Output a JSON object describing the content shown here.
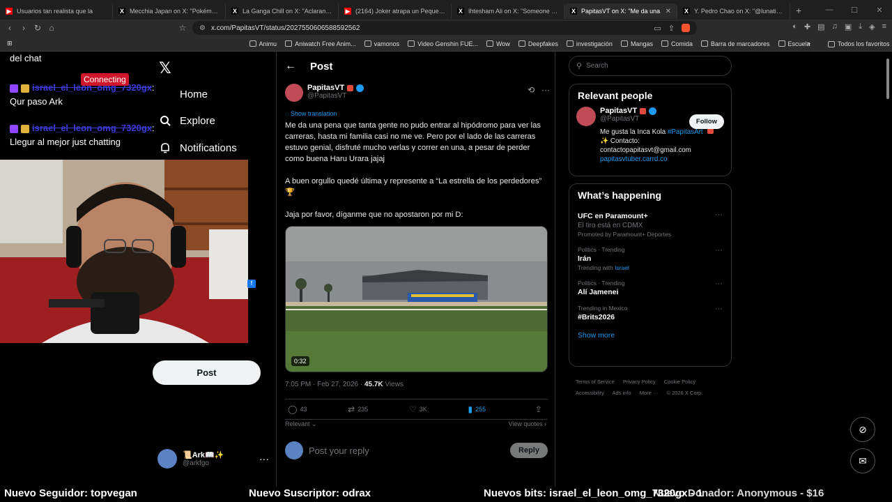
{
  "browser": {
    "tabs": [
      {
        "title": "Usuarios tan realista que la",
        "icon": "youtube-icon",
        "color": "#ff0000",
        "glyph": "▶"
      },
      {
        "title": "Mecchia Japan on X: \"Pokémon Fit",
        "icon": "x-icon",
        "color": "#000000",
        "glyph": "X"
      },
      {
        "title": "La Ganga Chill on X: \"Aclarando la s",
        "icon": "x-icon",
        "color": "#000000",
        "glyph": "X"
      },
      {
        "title": "(2164) Joker atrapa un Pequeño Pok",
        "icon": "youtube-icon",
        "color": "#ff0000",
        "glyph": "▶"
      },
      {
        "title": "Ihtesham Ali on X: \"Someone jus",
        "icon": "x-icon",
        "color": "#000000",
        "glyph": "X"
      },
      {
        "title": "PapitasVT on X: \"Me da una",
        "icon": "x-icon",
        "color": "#000000",
        "glyph": "X",
        "active": true
      },
      {
        "title": "Y. Pedro Chao on X: \"@lunaticmonst",
        "icon": "x-icon",
        "color": "#000000",
        "glyph": "X"
      }
    ],
    "url": "x.com/PapitasVT/status/2027550606588592562",
    "bookmarks": [
      "Animu",
      "Aniwatch Free Anim...",
      "vamonos",
      "Video Genshin FUE...",
      "Wow",
      "Deepfakes",
      "investigación",
      "Mangas",
      "Comida",
      "Barra de marcadores",
      "Escuela"
    ],
    "bookmarks_right": "Todos los favoritos"
  },
  "overlay": {
    "chat": [
      {
        "user": "",
        "msg": "del chat"
      },
      {
        "user": "israel_el_leon_omg_7320gx",
        "msg": ": Qur paso Ark"
      },
      {
        "user": "israel_el_leon_omg_7320gx",
        "msg": ": Llegur al mejor just chatting"
      }
    ],
    "connecting": "Connecting",
    "ticker": [
      "Nuevo Seguidor: topvegan",
      "Nuevo Suscriptor: odrax",
      "Nuevos bits: israel_el_leon_omg_7320gx - 1",
      "Nuevo Donador: Anonymous - $16"
    ]
  },
  "xnav": {
    "items": [
      {
        "label": "Home",
        "icon": "home-icon"
      },
      {
        "label": "Explore",
        "icon": "search-icon"
      },
      {
        "label": "Notifications",
        "icon": "bell-icon"
      }
    ],
    "post_label": "Post",
    "account": {
      "name": "📜Ark📖✨",
      "handle": "@arkfgo"
    }
  },
  "post": {
    "header": "Post",
    "author_name": "PapitasVT",
    "author_handle": "@PapitasVT",
    "show_translation": "Show translation",
    "paragraphs": [
      "Me da una pena que tanta gente no pudo entrar al hipódromo para ver las carreras, hasta mi familia casi no me ve. Pero por el lado de las carreras estuvo genial, disfruté mucho verlas y correr en una, a pesar de perder como buena Haru Urara jajaj",
      "A buen orgullo quedé última y represente a “La estrella de los perdedores” 🏆",
      "Jaja por favor, díganme que no apostaron por mi D:"
    ],
    "video_duration": "0:32",
    "timestamp": "7:05 PM · Feb 27, 2026 · ",
    "views": "45.7K",
    "views_label": " Views",
    "stats": {
      "replies": "43",
      "reposts": "235",
      "likes": "3K",
      "bookmarks": "255"
    },
    "relevant": "Relevant",
    "view_quotes": "View quotes",
    "reply_placeholder": "Post your reply",
    "reply_button": "Reply"
  },
  "sidebar": {
    "search_placeholder": "Search",
    "relevant_title": "Relevant people",
    "person": {
      "name": "PapitasVT",
      "handle": "@PapitasVT",
      "follow": "Follow",
      "bio1": "Me gusta la Inca Kola ",
      "bio_tag": "#PapitasArt",
      "bio2": "✨ Contacto: contactopapitasvt@gmail.com",
      "bio_link": "papitasvtuber.carrd.co"
    },
    "happening_title": "What’s happening",
    "trends": [
      {
        "top": "",
        "title": "UFC en Paramount+",
        "sub": "El tiro está en CDMX",
        "extra": "Promoted by Paramount+ Deportes"
      },
      {
        "top": "Politics · Trending",
        "title": "Irán",
        "sub": "Trending with Israel",
        "extra": ""
      },
      {
        "top": "Politics · Trending",
        "title": "Alí Jamenei",
        "sub": "",
        "extra": ""
      },
      {
        "top": "Trending in Mexico",
        "title": "#Brits2026",
        "sub": "",
        "extra": ""
      }
    ],
    "show_more": "Show more",
    "footer": [
      "Terms of Service",
      "Privacy Policy",
      "Cookie Policy",
      "Accessibility",
      "Ads info",
      "More ···",
      "© 2026 X Corp."
    ]
  },
  "colors": {
    "accent": "#1d9bf0",
    "background": "#000000"
  }
}
